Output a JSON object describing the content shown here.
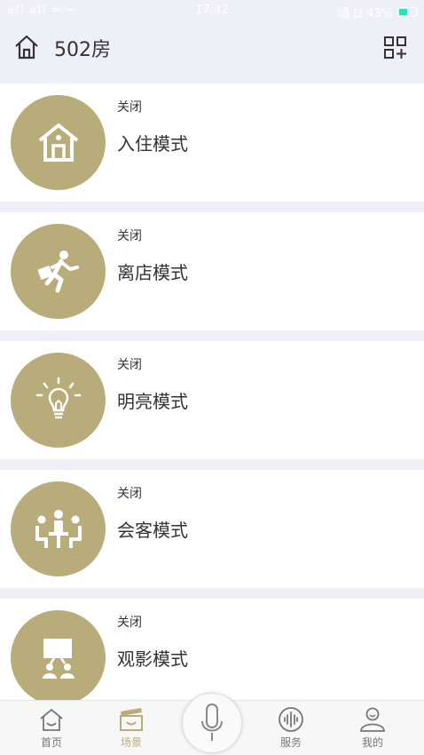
{
  "status_bar": {
    "signal": "atl atl ≈ ∼",
    "time": "17:42",
    "battery_text": "通 ⊡ 43%"
  },
  "header": {
    "room_title": "502房"
  },
  "scenes": [
    {
      "status": "关闭",
      "name": "入住模式",
      "icon": "house-icon"
    },
    {
      "status": "关闭",
      "name": "离店模式",
      "icon": "running-person-icon"
    },
    {
      "status": "关闭",
      "name": "明亮模式",
      "icon": "lightbulb-icon"
    },
    {
      "status": "关闭",
      "name": "会客模式",
      "icon": "meeting-icon"
    },
    {
      "status": "关闭",
      "name": "观影模式",
      "icon": "movie-screen-icon"
    }
  ],
  "tabbar": {
    "home": "首页",
    "scenes": "场景",
    "service": "服务",
    "mine": "我的"
  },
  "colors": {
    "accent": "#b9ac7b",
    "background": "#efeff7"
  }
}
